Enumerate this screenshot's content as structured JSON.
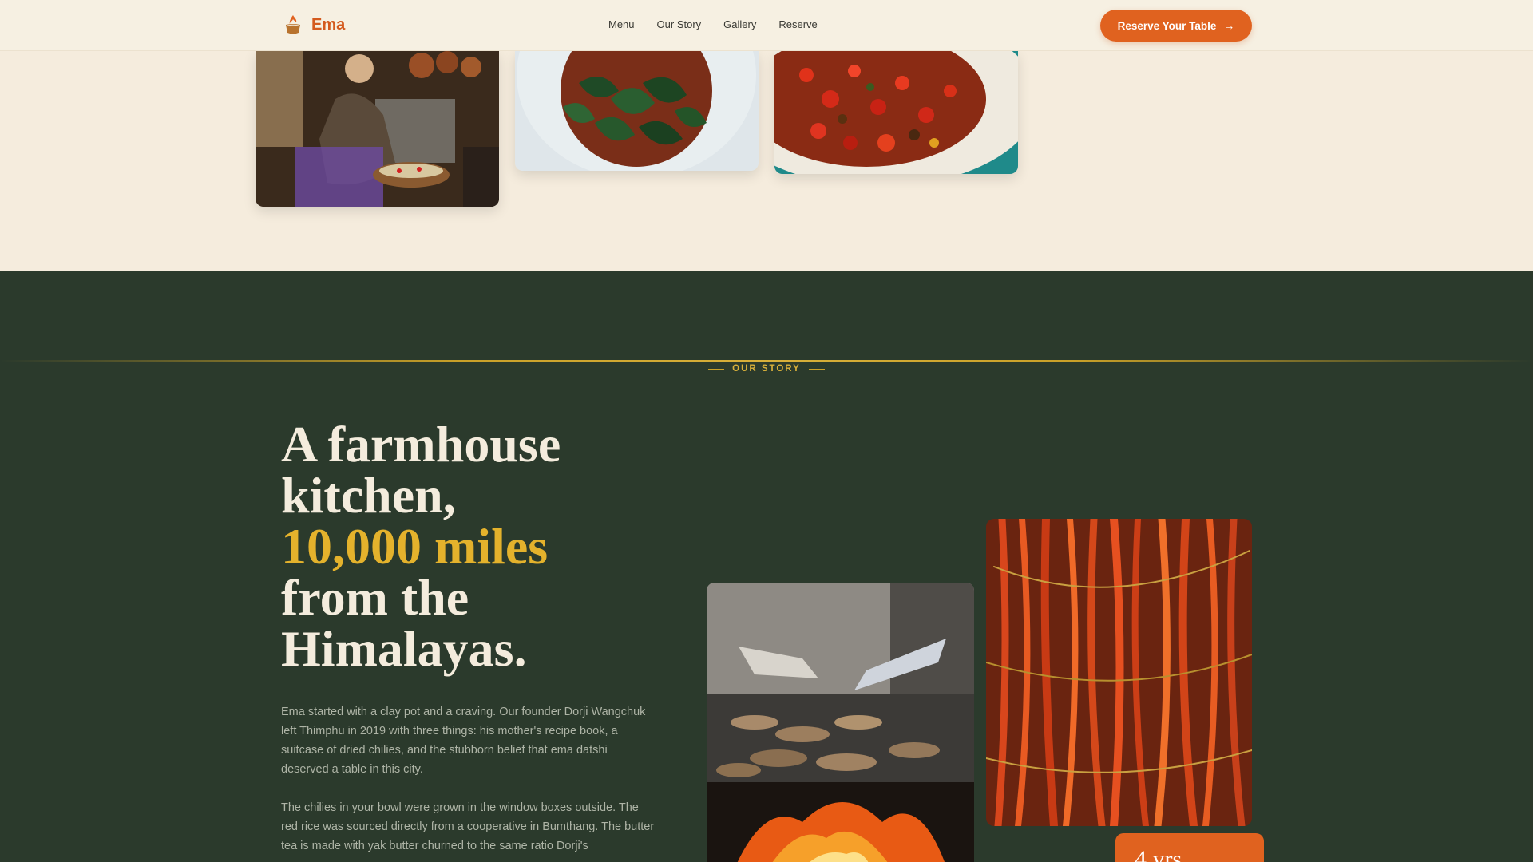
{
  "brand": {
    "name": "Ema",
    "accent": "#E0621F",
    "icon": "flame-pot-icon"
  },
  "nav": {
    "links": [
      "Menu",
      "Our Story",
      "Gallery",
      "Reserve"
    ],
    "cta_label": "Reserve Your Table",
    "cta_icon": "arrow-right-icon"
  },
  "gallery": {
    "images": [
      "cook-preparing-food-photo",
      "leafy-greens-bowl-photo",
      "red-chili-dish-photo"
    ]
  },
  "story": {
    "eyebrow": "OUR STORY",
    "headline_line1": "A farmhouse",
    "headline_line2": "kitchen,",
    "headline_accent": "10,000 miles",
    "headline_line4": "from the",
    "headline_line5": "Himalayas.",
    "para1": "Ema started with a clay pot and a craving. Our founder Dorji Wangchuk left Thimphu in 2019 with three things: his mother's recipe book, a suitcase of dried chilies, and the stubborn belief that ema datshi deserved a table in this city.",
    "para2": "The chilies in your bowl were grown in the window boxes outside. The red rice was sourced directly from a cooperative in Bumthang. The butter tea is made with yak butter churned to the same ratio Dorji's",
    "badge": "4 yrs",
    "colors": {
      "bg": "#2B3A2C",
      "gold": "#E4B22C",
      "text": "#F4ECDD"
    }
  }
}
